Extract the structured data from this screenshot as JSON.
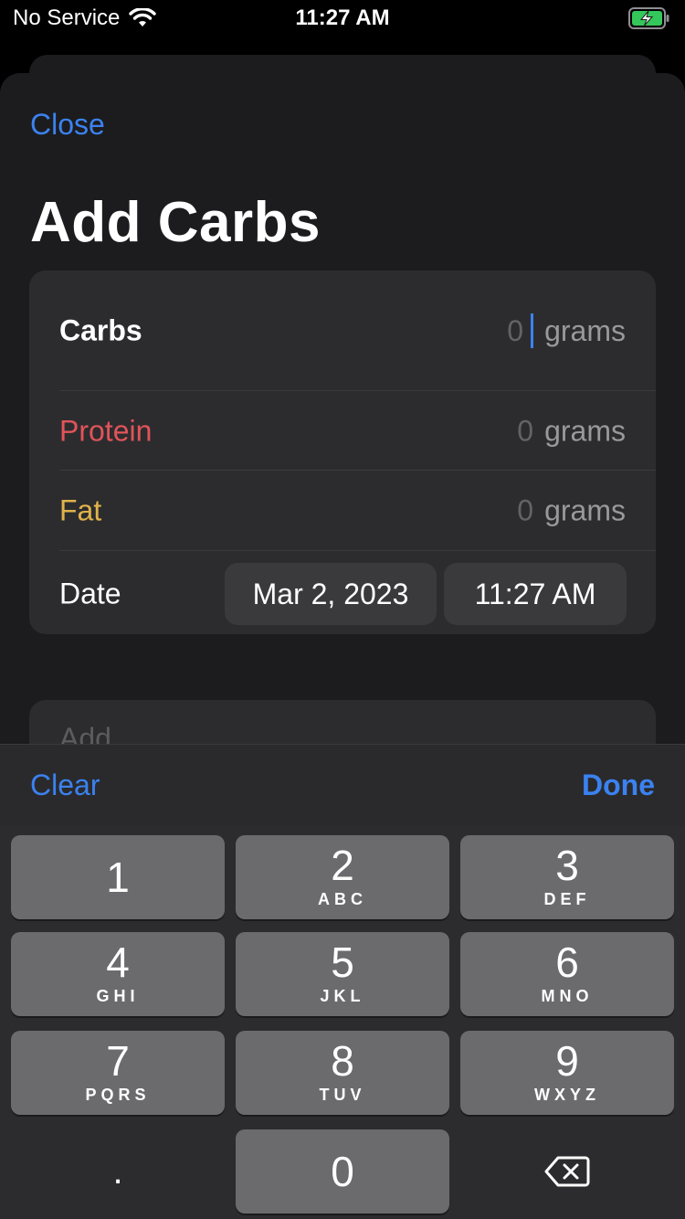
{
  "status": {
    "carrier": "No Service",
    "time": "11:27 AM",
    "battery_color": "#34c759"
  },
  "sheet": {
    "close_label": "Close",
    "title": "Add Carbs"
  },
  "form": {
    "carbs": {
      "label": "Carbs",
      "value": "0",
      "unit": "grams"
    },
    "protein": {
      "label": "Protein",
      "value": "0",
      "unit": "grams",
      "color": "#e0545a"
    },
    "fat": {
      "label": "Fat",
      "value": "0",
      "unit": "grams",
      "color": "#e0b24a"
    },
    "date": {
      "label": "Date",
      "date_value": "Mar 2, 2023",
      "time_value": "11:27 AM"
    }
  },
  "add_section": {
    "label": "Add"
  },
  "keyboard": {
    "clear_label": "Clear",
    "done_label": "Done",
    "keys": [
      {
        "num": "1",
        "letters": ""
      },
      {
        "num": "2",
        "letters": "ABC"
      },
      {
        "num": "3",
        "letters": "DEF"
      },
      {
        "num": "4",
        "letters": "GHI"
      },
      {
        "num": "5",
        "letters": "JKL"
      },
      {
        "num": "6",
        "letters": "MNO"
      },
      {
        "num": "7",
        "letters": "PQRS"
      },
      {
        "num": "8",
        "letters": "TUV"
      },
      {
        "num": "9",
        "letters": "WXYZ"
      }
    ],
    "decimal": ".",
    "zero": "0"
  },
  "colors": {
    "accent": "#3b82f0",
    "background": "#1c1c1e",
    "card": "#2c2c2e"
  }
}
